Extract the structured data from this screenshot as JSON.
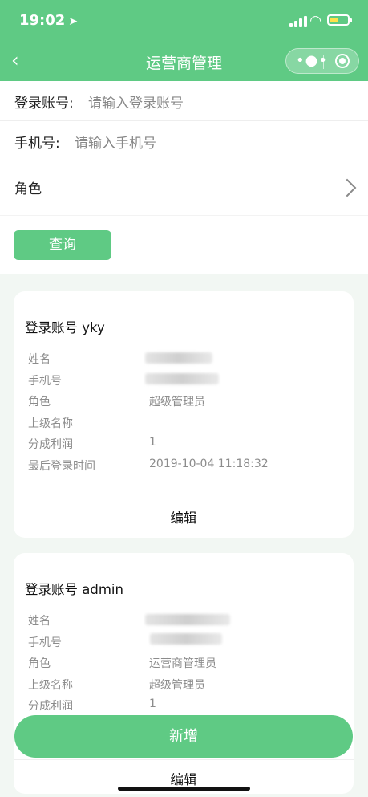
{
  "status_bar": {
    "time": "19:02",
    "location_icon": "location-arrow-icon"
  },
  "navbar": {
    "title": "运营商管理",
    "back_icon": "chevron-left-icon"
  },
  "filters": {
    "account_label": "登录账号:",
    "account_placeholder": "请输入登录账号",
    "phone_label": "手机号:",
    "phone_placeholder": "请输入手机号",
    "role_label": "角色",
    "query_button": "查询"
  },
  "cards": [
    {
      "title": "登录账号 yky",
      "fields": [
        {
          "label": "姓名",
          "value": ""
        },
        {
          "label": "手机号",
          "value": ""
        },
        {
          "label": "角色",
          "value": "超级管理员"
        },
        {
          "label": "上级名称",
          "value": ""
        },
        {
          "label": "分成利润",
          "value": "1"
        },
        {
          "label": "最后登录时间",
          "value": "2019-10-04 11:18:32"
        }
      ],
      "action": "编辑"
    },
    {
      "title": "登录账号 admin",
      "fields": [
        {
          "label": "姓名",
          "value": ""
        },
        {
          "label": "手机号",
          "value": ""
        },
        {
          "label": "角色",
          "value": "运营商管理员"
        },
        {
          "label": "上级名称",
          "value": "超级管理员"
        },
        {
          "label": "分成利润",
          "value": "1"
        }
      ],
      "action": "编辑"
    }
  ],
  "add_button": "新增",
  "colors": {
    "brand_green": "#5fca84",
    "page_bg": "#f2f7f3"
  }
}
